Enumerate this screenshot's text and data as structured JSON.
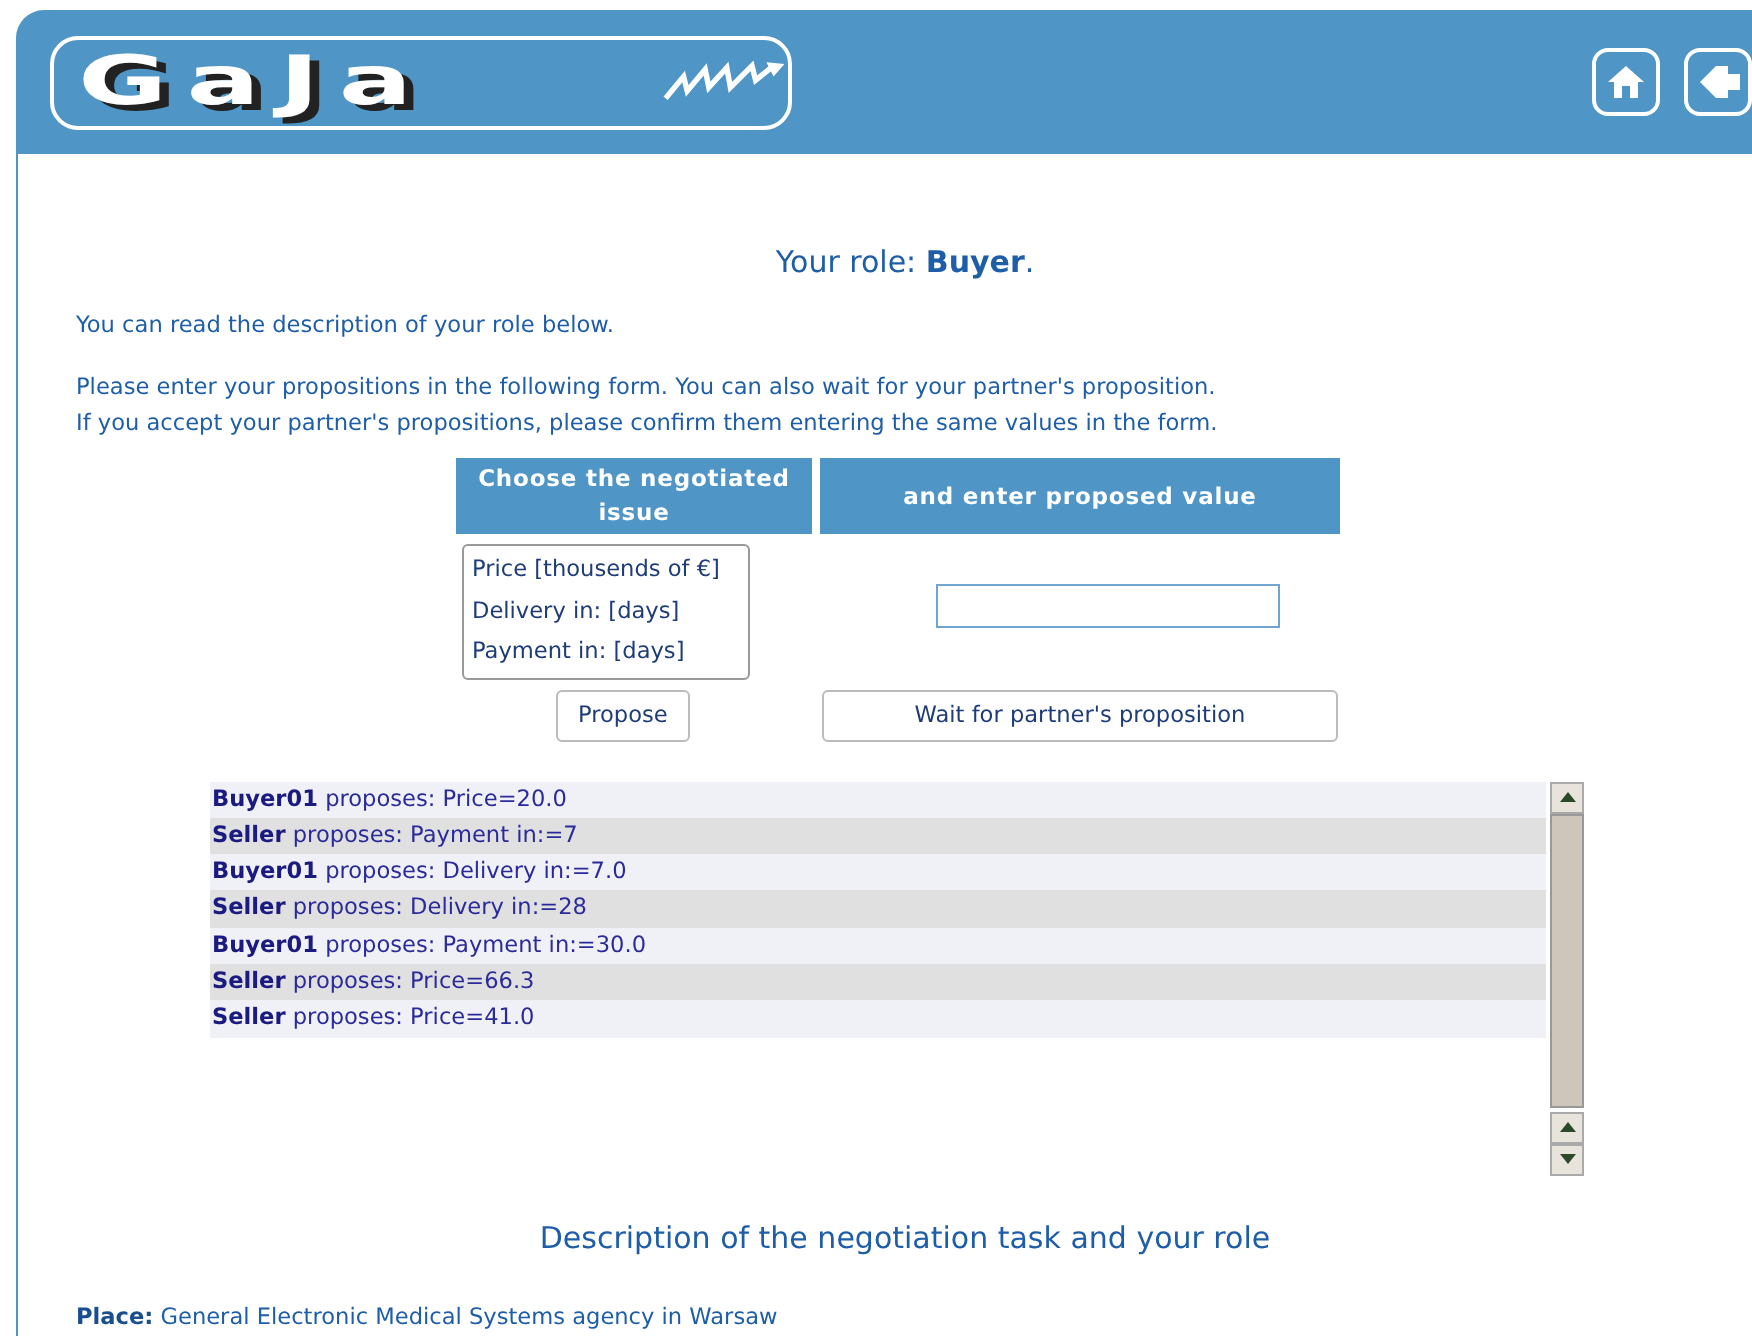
{
  "header": {
    "logo": "GaJa"
  },
  "role_title": "Your role: **Buyer**.",
  "intro": [
    "You can read the description of your role below.",
    "Please enter your propositions in the following form. You can also wait for your partner's proposition.",
    "If you accept your partner's propositions, please confirm them entering the same values in the form."
  ],
  "form": {
    "columns": [
      "Choose the negotiated issue",
      "and enter proposed value"
    ],
    "issues": [
      {
        "label": "Price [thousends of €]",
        "selected": false
      },
      {
        "label": "Delivery in: [days]",
        "selected": false
      },
      {
        "label": "Payment in: [days]",
        "selected": false
      }
    ],
    "buttons": [
      "Propose",
      "Wait for partner's proposition"
    ]
  },
  "log": [
    "**Buyer01** proposes: Price=20.0",
    "**Seller** proposes: Payment in:=7",
    "**Buyer01** proposes: Delivery in:=7.0",
    "**Seller** proposes: Delivery in:=28",
    "**Buyer01** proposes: Payment in:=30.0",
    "**Seller** proposes: Price=66.3",
    "**Seller** proposes: Price=41.0"
  ],
  "description_title": "Description of the negotiation task and your role",
  "place": "**Place:** General Electronic Medical Systems agency in Warsaw"
}
